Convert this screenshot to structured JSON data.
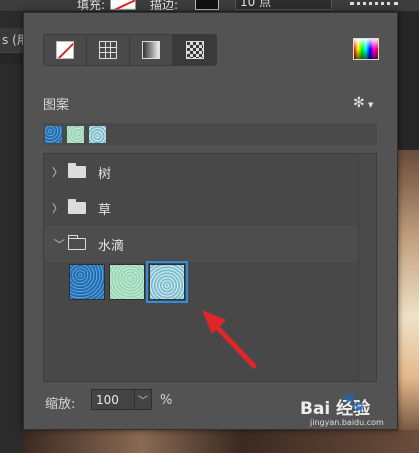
{
  "topbar": {
    "fill_label": "填充:",
    "stroke_label": "描边:",
    "stroke_width": "10 点",
    "left_cut": "s (用"
  },
  "panel": {
    "fill_types": [
      {
        "name": "no-color",
        "icon": "no-fill-icon"
      },
      {
        "name": "solid-color",
        "icon": "solid-color-icon"
      },
      {
        "name": "gradient",
        "icon": "gradient-icon"
      },
      {
        "name": "pattern",
        "icon": "pattern-icon",
        "active": true
      }
    ],
    "color_picker_icon": "color-picker-icon",
    "section_title": "图案",
    "settings_icon": "gear-icon",
    "recent_patterns": [
      "blue-water",
      "green-water",
      "teal-water"
    ],
    "tree": [
      {
        "label": "树",
        "expanded": false
      },
      {
        "label": "草",
        "expanded": false
      },
      {
        "label": "水滴",
        "expanded": true,
        "patterns": [
          "blue-water",
          "green-water",
          "teal-water"
        ],
        "selected_index": 2
      }
    ],
    "zoom": {
      "label": "缩放:",
      "value": "100",
      "unit": "%"
    }
  },
  "watermark": {
    "brand": "Bai  经验",
    "url": "jingyan.baidu.com"
  },
  "colors": {
    "panel_bg": "#535353",
    "selection": "#2f8ee0",
    "arrow": "#e0262b"
  }
}
